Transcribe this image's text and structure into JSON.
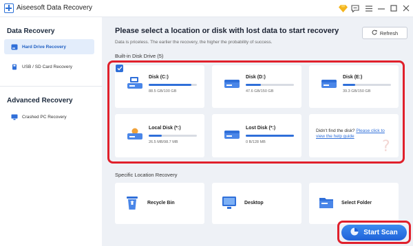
{
  "app": {
    "title": "Aiseesoft Data Recovery"
  },
  "titlebar": {
    "icons": [
      "diamond-icon",
      "chat-icon",
      "menu-icon",
      "minimize-icon",
      "maximize-icon",
      "close-icon"
    ]
  },
  "sidebar": {
    "data_recovery_heading": "Data Recovery",
    "items": [
      {
        "label": "Hard Drive Recovery",
        "icon": "hard-drive-icon",
        "active": true
      },
      {
        "label": "USB / SD Card Recovery",
        "icon": "usb-icon",
        "active": false
      }
    ],
    "advanced_heading": "Advanced Recovery",
    "advanced_items": [
      {
        "label": "Crashed PC Recovery",
        "icon": "monitor-icon",
        "active": false
      }
    ]
  },
  "main": {
    "headline": "Please select a location or disk with lost data to start recovery",
    "subline": "Data is priceless. The earlier the recovery, the higher the probability of success.",
    "refresh_label": "Refresh",
    "builtin_label": "Built-in Disk Drive (5)",
    "disks": [
      {
        "name": "Disk (C:)",
        "size": "88.5 GB/100 GB",
        "usage": 0.885,
        "type": "system"
      },
      {
        "name": "Disk (D:)",
        "size": "47.6 GB/150 GB",
        "usage": 0.317,
        "type": "standard"
      },
      {
        "name": "Disk (E:)",
        "size": "39.3 GB/150 GB",
        "usage": 0.262,
        "type": "standard"
      },
      {
        "name": "Local Disk (*:)",
        "size": "26.5 MB/98.7 MB",
        "usage": 0.268,
        "type": "orange"
      },
      {
        "name": "Lost Disk (*:)",
        "size": "0 B/128 MB",
        "usage": 1.0,
        "type": "standard"
      }
    ],
    "help_text": "Didn't find the disk?",
    "help_link": "Please click to view the help guide",
    "specific_label": "Specific Location Recovery",
    "locations": [
      {
        "name": "Recycle Bin",
        "icon": "recycle-bin-icon"
      },
      {
        "name": "Desktop",
        "icon": "desktop-icon"
      },
      {
        "name": "Select Folder",
        "icon": "folder-icon"
      }
    ],
    "scan_label": "Start Scan"
  },
  "colors": {
    "accent": "#2f6fd9",
    "highlight": "#e0202b",
    "bar_track": "#d8dce3"
  }
}
